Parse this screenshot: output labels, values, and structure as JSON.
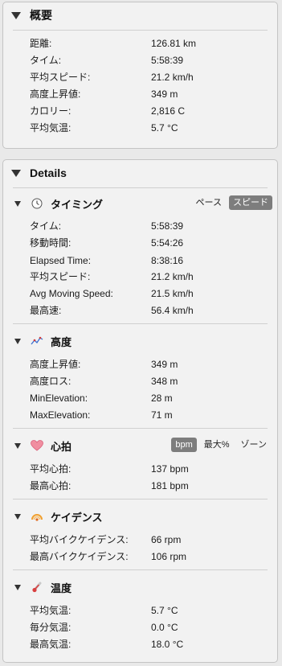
{
  "summary": {
    "title": "概要",
    "rows": [
      {
        "label": "距離:",
        "value": "126.81 km"
      },
      {
        "label": "タイム:",
        "value": "5:58:39"
      },
      {
        "label": "平均スピード:",
        "value": "21.2 km/h"
      },
      {
        "label": "高度上昇値:",
        "value": "349 m"
      },
      {
        "label": "カロリー:",
        "value": "2,816 C"
      },
      {
        "label": "平均気温:",
        "value": "5.7 °C"
      }
    ]
  },
  "details": {
    "title": "Details",
    "timing": {
      "title": "タイミング",
      "icon": "clock-icon",
      "toggle": {
        "pace": "ペース",
        "speed": "スピード",
        "selected": "speed"
      },
      "rows": [
        {
          "label": "タイム:",
          "value": "5:58:39"
        },
        {
          "label": "移動時間:",
          "value": "5:54:26"
        },
        {
          "label": "Elapsed Time:",
          "value": "8:38:16"
        },
        {
          "label": "平均スピード:",
          "value": "21.2 km/h"
        },
        {
          "label": "Avg Moving Speed:",
          "value": "21.5 km/h"
        },
        {
          "label": "最高速:",
          "value": "56.4 km/h"
        }
      ]
    },
    "elevation": {
      "title": "高度",
      "icon": "elevation-chart-icon",
      "rows": [
        {
          "label": "高度上昇値:",
          "value": "349 m"
        },
        {
          "label": "高度ロス:",
          "value": "348 m"
        },
        {
          "label": "MinElevation:",
          "value": "28 m"
        },
        {
          "label": "MaxElevation:",
          "value": "71 m"
        }
      ]
    },
    "heart_rate": {
      "title": "心拍",
      "icon": "heart-icon",
      "toggle": {
        "bpm": "bpm",
        "max_pct": "最大%",
        "zone": "ゾーン",
        "selected": "bpm"
      },
      "rows": [
        {
          "label": "平均心拍:",
          "value": "137 bpm"
        },
        {
          "label": "最高心拍:",
          "value": "181 bpm"
        }
      ]
    },
    "cadence": {
      "title": "ケイデンス",
      "icon": "cadence-icon",
      "rows": [
        {
          "label": "平均バイクケイデンス:",
          "value": "66 rpm"
        },
        {
          "label": "最高バイクケイデンス:",
          "value": "106 rpm"
        }
      ]
    },
    "temperature": {
      "title": "温度",
      "icon": "thermometer-icon",
      "rows": [
        {
          "label": "平均気温:",
          "value": "5.7 °C"
        },
        {
          "label": "毎分気温:",
          "value": "0.0 °C"
        },
        {
          "label": "最高気温:",
          "value": "18.0 °C"
        }
      ]
    }
  }
}
